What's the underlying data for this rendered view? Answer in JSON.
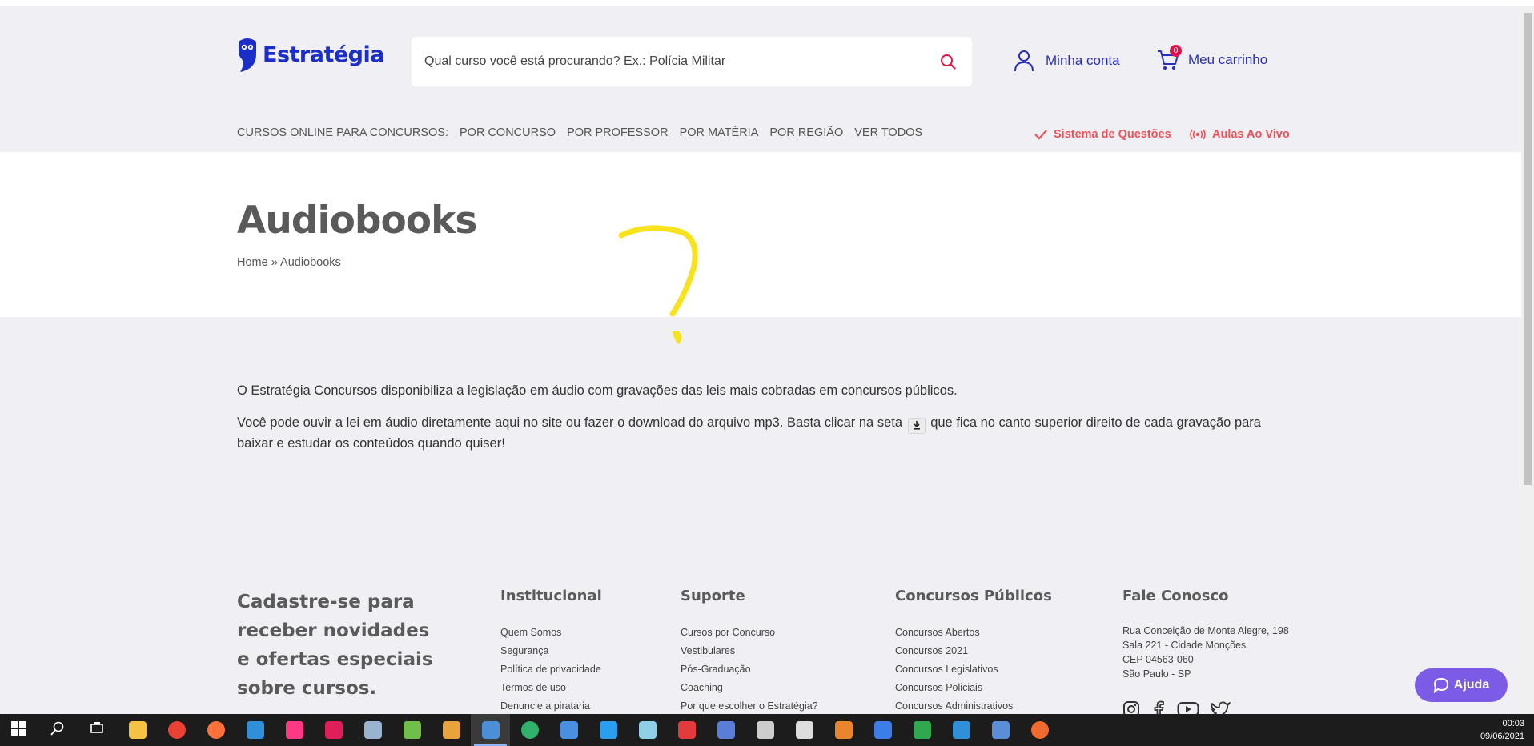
{
  "header": {
    "logo_text": "Estratégia",
    "search_placeholder": "Qual curso você está procurando? Ex.: Polícia Militar",
    "account_label": "Minha conta",
    "cart_label": "Meu carrinho",
    "cart_count": "0",
    "nav_prefix": "CURSOS ONLINE PARA CONCURSOS:",
    "nav_items": [
      "POR CONCURSO",
      "POR PROFESSOR",
      "POR MATÉRIA",
      "POR REGIÃO",
      "VER TODOS"
    ],
    "quick_links": {
      "questoes": "Sistema de Questões",
      "aulas": "Aulas Ao Vivo"
    }
  },
  "hero": {
    "title": "Audiobooks",
    "breadcrumb": {
      "home": "Home",
      "separator": "»",
      "current": "Audiobooks"
    }
  },
  "content": {
    "paragraph1": "O Estratégia Concursos disponibiliza a legislação em áudio com gravações das leis mais cobradas em concursos públicos.",
    "paragraph2_before": "Você pode ouvir a lei em áudio diretamente aqui no site ou fazer o download do arquivo mp3. Basta clicar na seta",
    "paragraph2_after": "que fica no canto superior direito de cada gravação para baixar e estudar os conteúdos quando quiser!"
  },
  "footer": {
    "signup_text": "Cadastre-se para receber novidades e ofertas especiais sobre cursos.",
    "institucional": {
      "title": "Institucional",
      "links": [
        "Quem Somos",
        "Segurança",
        "Política de privacidade",
        "Termos de uso",
        "Denuncie a pirataria"
      ]
    },
    "suporte": {
      "title": "Suporte",
      "links": [
        "Cursos por Concurso",
        "Vestibulares",
        "Pós-Graduação",
        "Coaching",
        "Por que escolher o Estratégia?"
      ]
    },
    "concursos": {
      "title": "Concursos Públicos",
      "links": [
        "Concursos Abertos",
        "Concursos 2021",
        "Concursos Legislativos",
        "Concursos Policiais",
        "Concursos Administrativos"
      ]
    },
    "contato": {
      "title": "Fale Conosco",
      "lines": [
        "Rua Conceição de Monte Alegre, 198",
        "Sala 221 - Cidade Monções",
        "CEP 04563-060",
        "São Paulo - SP"
      ]
    }
  },
  "help_button": "Ajuda",
  "taskbar": {
    "time": "00:03",
    "date": "09/06/2021",
    "apps": [
      {
        "icon": "windows-start-icon",
        "color": "#ffffff"
      },
      {
        "icon": "search-icon",
        "color": "#ffffff"
      },
      {
        "icon": "task-view-icon",
        "color": "#ffffff"
      },
      {
        "icon": "file-explorer-icon",
        "color": "#f5c342"
      },
      {
        "icon": "chrome-icon",
        "color": "#e94235"
      },
      {
        "icon": "firefox-icon",
        "color": "#ff7139"
      },
      {
        "icon": "app-icon",
        "color": "#2f8fd8"
      },
      {
        "icon": "intellij-icon",
        "color": "#fc3a84"
      },
      {
        "icon": "slack-icon",
        "color": "#e01e5a"
      },
      {
        "icon": "app-icon",
        "color": "#9ab4cf"
      },
      {
        "icon": "app-icon",
        "color": "#6fbf4a"
      },
      {
        "icon": "app-icon",
        "color": "#e8a33d"
      },
      {
        "icon": "app-icon",
        "color": "#4a8fd8"
      },
      {
        "icon": "edge-icon",
        "color": "#2fb36b"
      },
      {
        "icon": "app-icon",
        "color": "#4a90e2"
      },
      {
        "icon": "vscode-icon",
        "color": "#2a9ff0"
      },
      {
        "icon": "app-icon",
        "color": "#8fd0e8"
      },
      {
        "icon": "app-icon",
        "color": "#e33b3b"
      },
      {
        "icon": "app-icon",
        "color": "#5a7dd8"
      },
      {
        "icon": "app-icon",
        "color": "#cccccc"
      },
      {
        "icon": "app-icon",
        "color": "#dddddd"
      },
      {
        "icon": "app-icon",
        "color": "#e9862d"
      },
      {
        "icon": "app-icon",
        "color": "#3d7de8"
      },
      {
        "icon": "app-icon",
        "color": "#2fa84f"
      },
      {
        "icon": "app-icon",
        "color": "#2f8fd8"
      },
      {
        "icon": "calculator-icon",
        "color": "#5a8fd8"
      },
      {
        "icon": "app-icon",
        "color": "#f06a2d"
      }
    ],
    "active_index": 12
  },
  "colors": {
    "brand": "#1b2ec7",
    "accent": "#e8545a",
    "help": "#7c5ce6",
    "annotation": "#f7e21b"
  }
}
